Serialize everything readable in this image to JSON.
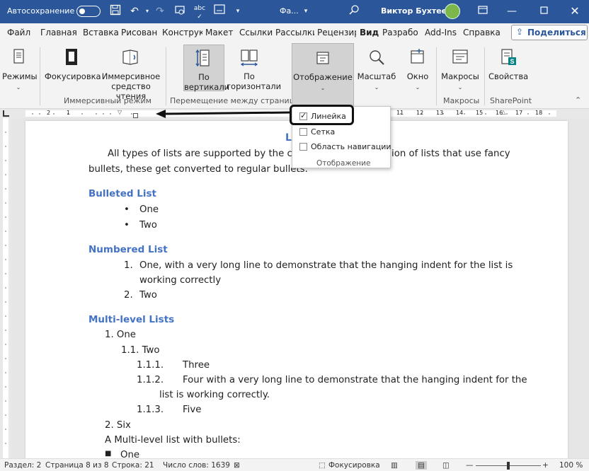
{
  "titlebar": {
    "autosave_label": "Автосохранение",
    "autosave_state": "off",
    "filename": "Фа...",
    "user_name": "Виктор Бухтеев",
    "color": "#2b579a",
    "icons": [
      "save-icon",
      "undo-icon",
      "redo-icon",
      "touch-mode-icon",
      "spelling-icon",
      "read-mode-icon",
      "customize-qat-icon",
      "search-icon",
      "ribbon-display-icon",
      "minimize-icon",
      "maximize-icon",
      "close-icon"
    ]
  },
  "tabs": [
    {
      "label": "Файл"
    },
    {
      "label": "Главная"
    },
    {
      "label": "Вставка"
    },
    {
      "label": "Рисован"
    },
    {
      "label": "Конструк"
    },
    {
      "label": "Макет"
    },
    {
      "label": "Ссылки"
    },
    {
      "label": "Рассылки"
    },
    {
      "label": "Рецензир"
    },
    {
      "label": "Вид",
      "active": true
    },
    {
      "label": "Разрабо"
    },
    {
      "label": "Add-Ins"
    },
    {
      "label": "Справка"
    }
  ],
  "share_label": "Поделиться",
  "ribbon": {
    "modes": "Режимы",
    "focus": "Фокусировка",
    "immersive_reader_1": "Иммерсивное",
    "immersive_reader_2": "средство чтения",
    "vertical_1": "По",
    "vertical_2": "вертикали",
    "horizontal_1": "По",
    "horizontal_2": "горизонтали",
    "show": "Отображение",
    "zoom": "Масштаб",
    "window": "Окно",
    "macros": "Макросы",
    "properties": "Свойства",
    "groups": {
      "immersive": "Иммерсивный режим",
      "page_movement": "Перемещение между страницами",
      "macros": "Макросы",
      "sharepoint": "SharePoint"
    }
  },
  "dropdown": {
    "items": [
      {
        "label": "Линейка",
        "checked": true
      },
      {
        "label": "Сетка",
        "checked": false
      },
      {
        "label": "Область навигации",
        "checked": false
      }
    ],
    "group_label": "Отображение"
  },
  "ruler": {
    "left_labels": [
      "2",
      "1"
    ],
    "right_labels": [
      "11",
      "12",
      "13",
      "14",
      "15",
      "16",
      "17",
      "18"
    ]
  },
  "document": {
    "title_fragment": "L",
    "intro_1a": "All types of lists are supported by the conv",
    "intro_1b": "ion of lists that use fancy",
    "intro_2": "bullets, these get converted to regular bullets.",
    "h_bulleted": "Bulleted List",
    "bullets": [
      "One",
      "Two"
    ],
    "h_numbered": "Numbered List",
    "num1_marker": "1.",
    "num1_a": "One, with a very long line to demonstrate that the hanging indent for the list is",
    "num1_b": "working correctly",
    "num2_marker": "2.",
    "num2": "Two",
    "h_multilevel": "Multi-level Lists",
    "ml_1": "1.  One",
    "ml_11": "1.1. Two",
    "ml_111_marker": "1.1.1.",
    "ml_111": "Three",
    "ml_112_marker": "1.1.2.",
    "ml_112a": "Four with a very long line to demonstrate that the hanging indent for the",
    "ml_112b": "list is working correctly.",
    "ml_113_marker": "1.1.3.",
    "ml_113": "Five",
    "ml_2": "2.  Six",
    "ml_bullets_intro": "A Multi-level list with bullets:",
    "ml_bullet_one": "One"
  },
  "statusbar": {
    "section": "Раздел: 2",
    "page": "Страница 8 из 8",
    "line": "Строка: 21",
    "words": "Число слов: 1639",
    "focus": "Фокусировка",
    "zoom": "100 %",
    "zoom_level_percent": 100
  }
}
